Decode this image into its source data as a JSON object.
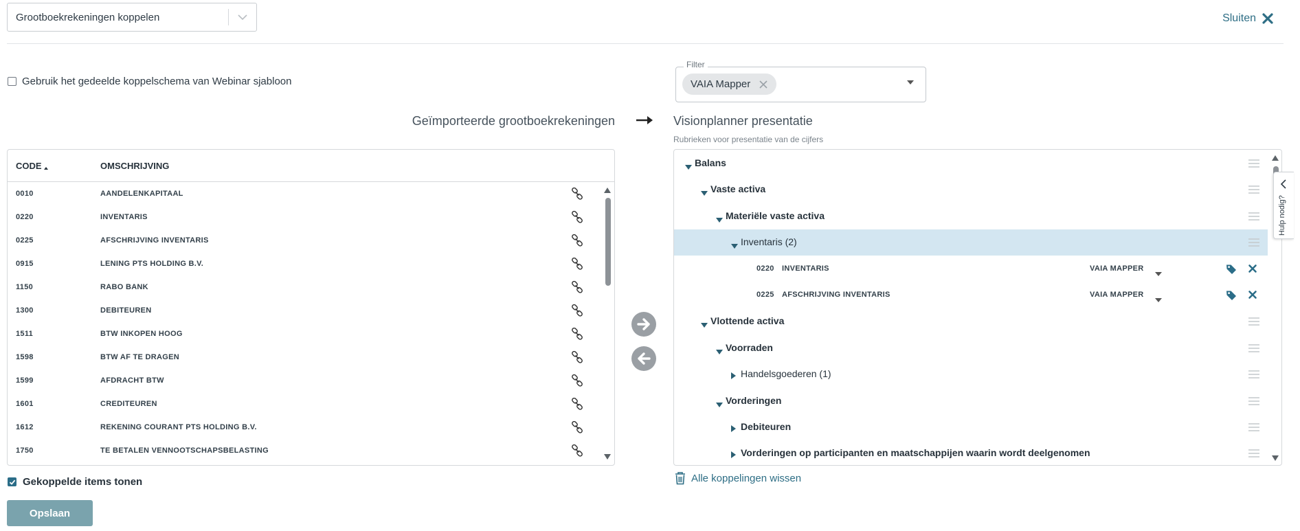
{
  "module_select": {
    "value": "Grootboekrekeningen koppelen"
  },
  "close": {
    "label": "Sluiten"
  },
  "shared_schema": {
    "label": "Gebruik het gedeelde koppelschema van Webinar sjabloon",
    "checked": false
  },
  "filter": {
    "legend": "Filter",
    "chip": "VAIA Mapper"
  },
  "left": {
    "heading": "Geïmporteerde grootboekrekeningen",
    "columns": {
      "code": "CODE",
      "description": "OMSCHRIJVING"
    },
    "rows": [
      {
        "code": "0010",
        "description": "AANDELENKAPITAAL"
      },
      {
        "code": "0220",
        "description": "INVENTARIS"
      },
      {
        "code": "0225",
        "description": "AFSCHRIJVING INVENTARIS"
      },
      {
        "code": "0915",
        "description": "LENING PTS HOLDING B.V."
      },
      {
        "code": "1150",
        "description": "RABO BANK"
      },
      {
        "code": "1300",
        "description": "DEBITEUREN"
      },
      {
        "code": "1511",
        "description": "BTW INKOPEN HOOG"
      },
      {
        "code": "1598",
        "description": "BTW AF TE DRAGEN"
      },
      {
        "code": "1599",
        "description": "AFDRACHT BTW"
      },
      {
        "code": "1601",
        "description": "CREDITEUREN"
      },
      {
        "code": "1612",
        "description": "REKENING COURANT PTS HOLDING B.V."
      },
      {
        "code": "1750",
        "description": "TE BETALEN VENNOOTSCHAPSBELASTING"
      }
    ]
  },
  "right": {
    "heading": "Visionplanner presentatie",
    "subheading": "Rubrieken voor presentatie van de cijfers",
    "tree": [
      {
        "label": "Balans",
        "expanded": true,
        "bold": true
      },
      {
        "label": "Vaste activa",
        "expanded": true,
        "bold": true
      },
      {
        "label": "Materiële vaste activa",
        "expanded": true,
        "bold": true
      },
      {
        "label": "Inventaris (2)",
        "expanded": true,
        "bold": false,
        "selected": true
      },
      {
        "code": "0220",
        "description": "INVENTARIS",
        "mapper": "VAIA MAPPER"
      },
      {
        "code": "0225",
        "description": "AFSCHRIJVING INVENTARIS",
        "mapper": "VAIA MAPPER"
      },
      {
        "label": "Vlottende activa",
        "expanded": true,
        "bold": true
      },
      {
        "label": "Voorraden",
        "expanded": true,
        "bold": true
      },
      {
        "label": "Handelsgoederen (1)",
        "expanded": false,
        "bold": false
      },
      {
        "label": "Vorderingen",
        "expanded": true,
        "bold": true
      },
      {
        "label": "Debiteuren",
        "expanded": false,
        "bold": true
      },
      {
        "label": "Vorderingen op participanten en maatschappijen waarin wordt deelgenomen",
        "expanded": false,
        "bold": true
      }
    ]
  },
  "help": {
    "label": "Hulp nodig?"
  },
  "show_linked": {
    "label": "Gekoppelde items tonen",
    "checked": true
  },
  "save": {
    "label": "Opslaan"
  },
  "clear_links": {
    "label": "Alle koppelingen wissen"
  },
  "colors": {
    "accent": "#2b6d88",
    "link": "#2e6e85",
    "selected_row": "#d3e6f1",
    "save_button": "#7aa3ad",
    "move_button": "#9a9fa4"
  },
  "icons": [
    "chevron-down-icon",
    "close-icon",
    "arrow-right-icon",
    "link-icon",
    "arrow-right-circle-icon",
    "arrow-left-circle-icon",
    "caret-down-icon",
    "caret-right-icon",
    "drag-handle-icon",
    "tag-icon",
    "remove-icon",
    "trash-icon",
    "chevron-left-icon"
  ]
}
